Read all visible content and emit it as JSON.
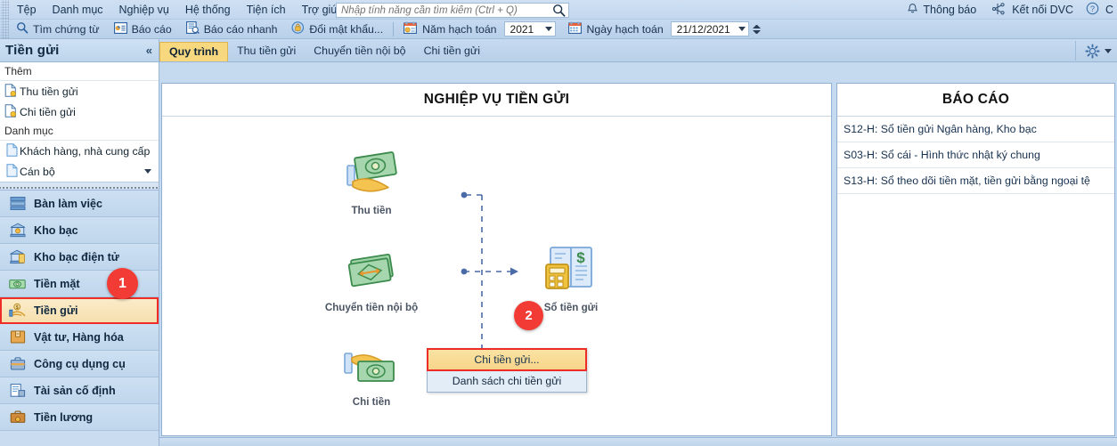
{
  "menubar": {
    "items": [
      "Tệp",
      "Danh mục",
      "Nghiệp vụ",
      "Hệ thống",
      "Tiện ích",
      "Trợ giúp"
    ],
    "search_placeholder": "Nhập tính năng cần tìm kiếm (Ctrl + Q)",
    "search_value": "",
    "notification_label": "Thông báo",
    "dvc_label": "Kết nối DVC",
    "trailing_label": "C"
  },
  "toolbar": {
    "find_document": "Tìm chứng từ",
    "report": "Báo cáo",
    "quick_report": "Báo cáo nhanh",
    "change_password": "Đổi mật khẩu...",
    "fiscal_year_label": "Năm hạch toán",
    "fiscal_year_value": "2021",
    "posting_date_label": "Ngày hạch toán",
    "posting_date_value": "21/12/2021"
  },
  "sidebar": {
    "title": "Tiền gửi",
    "collapse_glyph": "«",
    "groups": [
      {
        "label": "Thêm",
        "links": [
          "Thu tiền gửi",
          "Chi tiền gửi"
        ]
      },
      {
        "label": "Danh mục",
        "links": [
          "Khách hàng, nhà cung cấp",
          "Cán bộ"
        ]
      }
    ],
    "nav_items": [
      {
        "label": "Bàn làm việc",
        "icon": "workdesk-icon",
        "active": false
      },
      {
        "label": "Kho bạc",
        "icon": "treasury-icon",
        "active": false
      },
      {
        "label": "Kho bạc điện tử",
        "icon": "e-treasury-icon",
        "active": false
      },
      {
        "label": "Tiền mặt",
        "icon": "cash-icon",
        "active": false
      },
      {
        "label": "Tiền gửi",
        "icon": "deposit-icon",
        "active": true
      },
      {
        "label": "Vật tư, Hàng hóa",
        "icon": "goods-icon",
        "active": false
      },
      {
        "label": "Công cụ dụng cụ",
        "icon": "tools-icon",
        "active": false
      },
      {
        "label": "Tài sản cố định",
        "icon": "fixed-asset-icon",
        "active": false
      },
      {
        "label": "Tiền lương",
        "icon": "payroll-icon",
        "active": false
      }
    ]
  },
  "tabs": [
    {
      "label": "Quy trình",
      "active": true
    },
    {
      "label": "Thu tiền gửi",
      "active": false
    },
    {
      "label": "Chuyển tiền nội bộ",
      "active": false
    },
    {
      "label": "Chi tiền gửi",
      "active": false
    }
  ],
  "flow_panel": {
    "title": "NGHIỆP VỤ TIỀN GỬI",
    "nodes": [
      {
        "caption": "Thu tiền",
        "icon": "receive-money-icon"
      },
      {
        "caption": "Chuyển tiền nội bộ",
        "icon": "transfer-money-icon"
      },
      {
        "caption": "Sổ tiền gửi",
        "icon": "deposit-ledger-icon"
      },
      {
        "caption": "Chi tiền",
        "icon": "pay-money-icon"
      }
    ]
  },
  "context_menu": {
    "items": [
      {
        "label": "Chi tiền gửi...",
        "selected": true
      },
      {
        "label": "Danh sách chi tiền gửi",
        "selected": false
      }
    ]
  },
  "report_panel": {
    "title": "BÁO CÁO",
    "rows": [
      "S12-H: Sổ tiền gửi Ngân hàng, Kho bạc",
      "S03-H: Sổ cái - Hình thức nhật ký chung",
      "S13-H: Sổ theo dõi tiền mặt, tiền gửi bằng ngoại tệ"
    ]
  },
  "badges": [
    {
      "id": "1",
      "target": "sidebar-item-tien-gui"
    },
    {
      "id": "2",
      "target": "context-menu-chi-tien-gui"
    }
  ],
  "colors": {
    "accent_blue": "#c5d9ef",
    "active_tab": "#f8d87f",
    "highlight_red": "#ef2d28",
    "badge_red": "#f23b35",
    "panel_white": "#ffffff"
  }
}
